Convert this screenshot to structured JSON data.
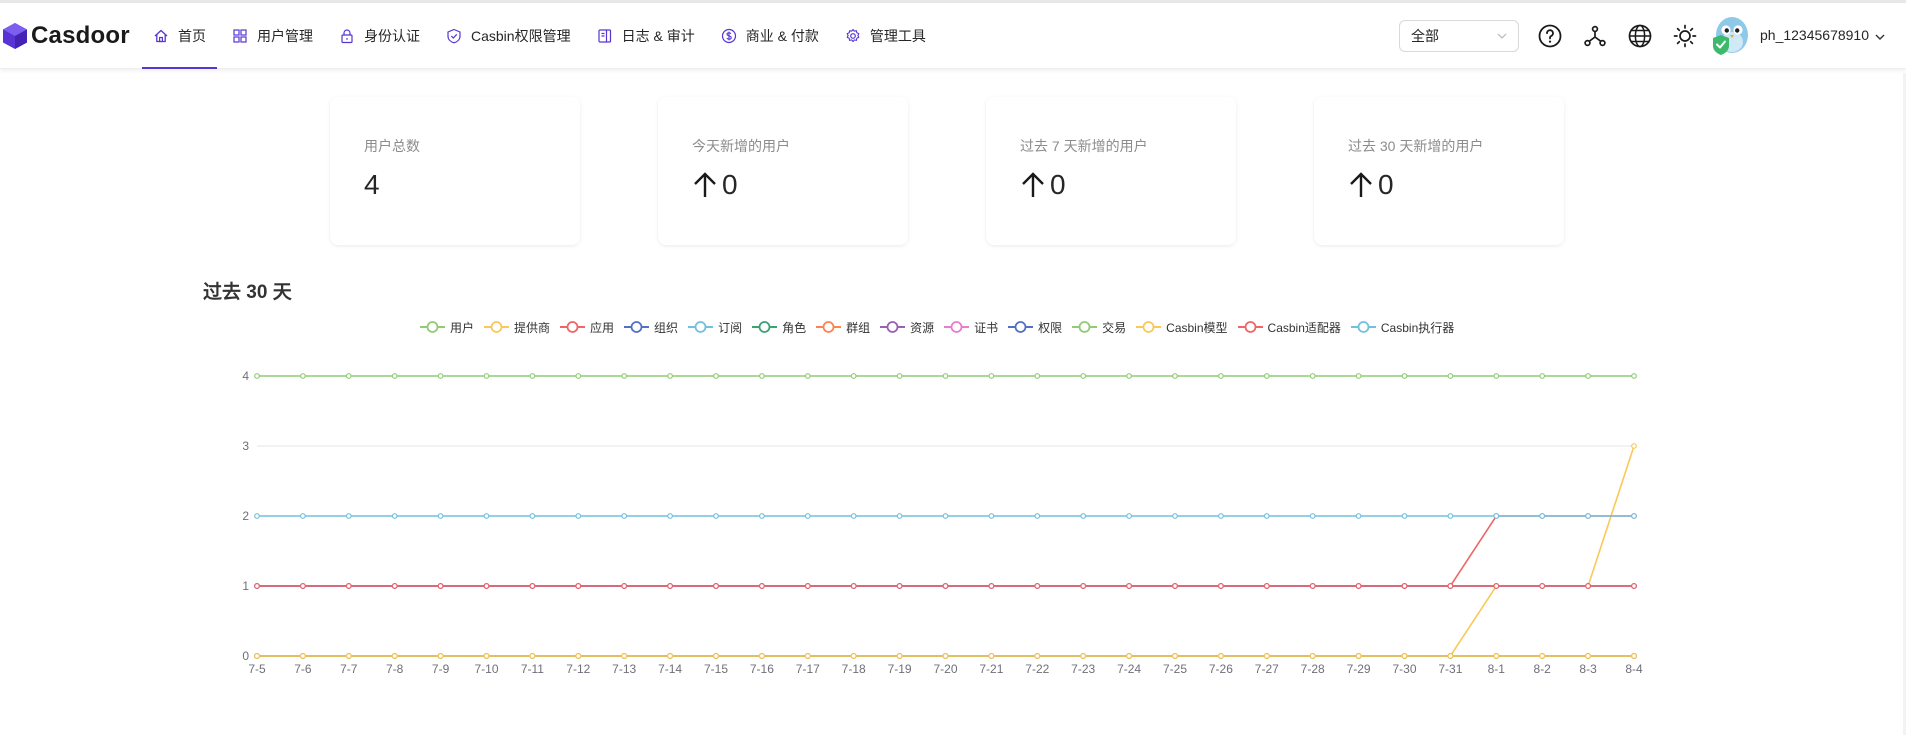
{
  "app": {
    "brand": "Casdoor"
  },
  "nav": {
    "items": [
      {
        "label": "首页",
        "icon": "home-icon",
        "active": true
      },
      {
        "label": "用户管理",
        "icon": "appstore-icon",
        "active": false
      },
      {
        "label": "身份认证",
        "icon": "lock-icon",
        "active": false
      },
      {
        "label": "Casbin权限管理",
        "icon": "safety-icon",
        "active": false
      },
      {
        "label": "日志 & 审计",
        "icon": "audit-icon",
        "active": false
      },
      {
        "label": "商业 & 付款",
        "icon": "dollar-icon",
        "active": false
      },
      {
        "label": "管理工具",
        "icon": "setting-icon",
        "active": false
      }
    ],
    "org_select": "全部",
    "username": "ph_12345678910",
    "header_icons": [
      "help-icon",
      "deployment-icon",
      "language-icon",
      "theme-icon"
    ]
  },
  "stats": [
    {
      "title": "用户总数",
      "value": "4",
      "arrow": false
    },
    {
      "title": "今天新增的用户",
      "value": "0",
      "arrow": true
    },
    {
      "title": "过去 7 天新增的用户",
      "value": "0",
      "arrow": true
    },
    {
      "title": "过去 30 天新增的用户",
      "value": "0",
      "arrow": true
    }
  ],
  "chart_data": {
    "type": "line",
    "title": "过去 30 天",
    "categories": [
      "7-5",
      "7-6",
      "7-7",
      "7-8",
      "7-9",
      "7-10",
      "7-11",
      "7-12",
      "7-13",
      "7-14",
      "7-15",
      "7-16",
      "7-17",
      "7-18",
      "7-19",
      "7-20",
      "7-21",
      "7-22",
      "7-23",
      "7-24",
      "7-25",
      "7-26",
      "7-27",
      "7-28",
      "7-29",
      "7-30",
      "7-31",
      "8-1",
      "8-2",
      "8-3",
      "8-4"
    ],
    "ylim": [
      0,
      4
    ],
    "yticks": [
      0,
      1,
      2,
      3,
      4
    ],
    "grid": true,
    "legend_position": "top-center",
    "series": [
      {
        "name": "用户",
        "color": "#91cc75",
        "values": [
          4,
          4,
          4,
          4,
          4,
          4,
          4,
          4,
          4,
          4,
          4,
          4,
          4,
          4,
          4,
          4,
          4,
          4,
          4,
          4,
          4,
          4,
          4,
          4,
          4,
          4,
          4,
          4,
          4,
          4,
          4
        ]
      },
      {
        "name": "提供商",
        "color": "#fac858",
        "values": [
          0,
          0,
          0,
          0,
          0,
          0,
          0,
          0,
          0,
          0,
          0,
          0,
          0,
          0,
          0,
          0,
          0,
          0,
          0,
          0,
          0,
          0,
          0,
          0,
          0,
          0,
          0,
          1,
          1,
          1,
          3
        ]
      },
      {
        "name": "应用",
        "color": "#ee6666",
        "values": [
          1,
          1,
          1,
          1,
          1,
          1,
          1,
          1,
          1,
          1,
          1,
          1,
          1,
          1,
          1,
          1,
          1,
          1,
          1,
          1,
          1,
          1,
          1,
          1,
          1,
          1,
          1,
          2,
          2,
          2,
          2
        ]
      },
      {
        "name": "组织",
        "color": "#5470c6",
        "values": [
          1,
          1,
          1,
          1,
          1,
          1,
          1,
          1,
          1,
          1,
          1,
          1,
          1,
          1,
          1,
          1,
          1,
          1,
          1,
          1,
          1,
          1,
          1,
          1,
          1,
          1,
          1,
          1,
          1,
          1,
          1
        ]
      },
      {
        "name": "订阅",
        "color": "#73c0de",
        "values": [
          0,
          0,
          0,
          0,
          0,
          0,
          0,
          0,
          0,
          0,
          0,
          0,
          0,
          0,
          0,
          0,
          0,
          0,
          0,
          0,
          0,
          0,
          0,
          0,
          0,
          0,
          0,
          0,
          0,
          0,
          0
        ]
      },
      {
        "name": "角色",
        "color": "#3ba272",
        "values": [
          0,
          0,
          0,
          0,
          0,
          0,
          0,
          0,
          0,
          0,
          0,
          0,
          0,
          0,
          0,
          0,
          0,
          0,
          0,
          0,
          0,
          0,
          0,
          0,
          0,
          0,
          0,
          0,
          0,
          0,
          0
        ]
      },
      {
        "name": "群组",
        "color": "#fc8452",
        "values": [
          0,
          0,
          0,
          0,
          0,
          0,
          0,
          0,
          0,
          0,
          0,
          0,
          0,
          0,
          0,
          0,
          0,
          0,
          0,
          0,
          0,
          0,
          0,
          0,
          0,
          0,
          0,
          0,
          0,
          0,
          0
        ]
      },
      {
        "name": "资源",
        "color": "#9a60b4",
        "values": [
          0,
          0,
          0,
          0,
          0,
          0,
          0,
          0,
          0,
          0,
          0,
          0,
          0,
          0,
          0,
          0,
          0,
          0,
          0,
          0,
          0,
          0,
          0,
          0,
          0,
          0,
          0,
          0,
          0,
          0,
          0
        ]
      },
      {
        "name": "证书",
        "color": "#ea7ccc",
        "values": [
          1,
          1,
          1,
          1,
          1,
          1,
          1,
          1,
          1,
          1,
          1,
          1,
          1,
          1,
          1,
          1,
          1,
          1,
          1,
          1,
          1,
          1,
          1,
          1,
          1,
          1,
          1,
          1,
          1,
          1,
          1
        ]
      },
      {
        "name": "权限",
        "color": "#5470c6",
        "values": [
          1,
          1,
          1,
          1,
          1,
          1,
          1,
          1,
          1,
          1,
          1,
          1,
          1,
          1,
          1,
          1,
          1,
          1,
          1,
          1,
          1,
          1,
          1,
          1,
          1,
          1,
          1,
          1,
          1,
          1,
          1
        ]
      },
      {
        "name": "交易",
        "color": "#91cc75",
        "values": [
          0,
          0,
          0,
          0,
          0,
          0,
          0,
          0,
          0,
          0,
          0,
          0,
          0,
          0,
          0,
          0,
          0,
          0,
          0,
          0,
          0,
          0,
          0,
          0,
          0,
          0,
          0,
          0,
          0,
          0,
          0
        ]
      },
      {
        "name": "Casbin模型",
        "color": "#fac858",
        "values": [
          0,
          0,
          0,
          0,
          0,
          0,
          0,
          0,
          0,
          0,
          0,
          0,
          0,
          0,
          0,
          0,
          0,
          0,
          0,
          0,
          0,
          0,
          0,
          0,
          0,
          0,
          0,
          0,
          0,
          0,
          0
        ]
      },
      {
        "name": "Casbin适配器",
        "color": "#ee6666",
        "values": [
          1,
          1,
          1,
          1,
          1,
          1,
          1,
          1,
          1,
          1,
          1,
          1,
          1,
          1,
          1,
          1,
          1,
          1,
          1,
          1,
          1,
          1,
          1,
          1,
          1,
          1,
          1,
          1,
          1,
          1,
          1
        ]
      },
      {
        "name": "Casbin执行器",
        "color": "#73c0de",
        "values": [
          2,
          2,
          2,
          2,
          2,
          2,
          2,
          2,
          2,
          2,
          2,
          2,
          2,
          2,
          2,
          2,
          2,
          2,
          2,
          2,
          2,
          2,
          2,
          2,
          2,
          2,
          2,
          2,
          2,
          2,
          2
        ]
      }
    ]
  }
}
